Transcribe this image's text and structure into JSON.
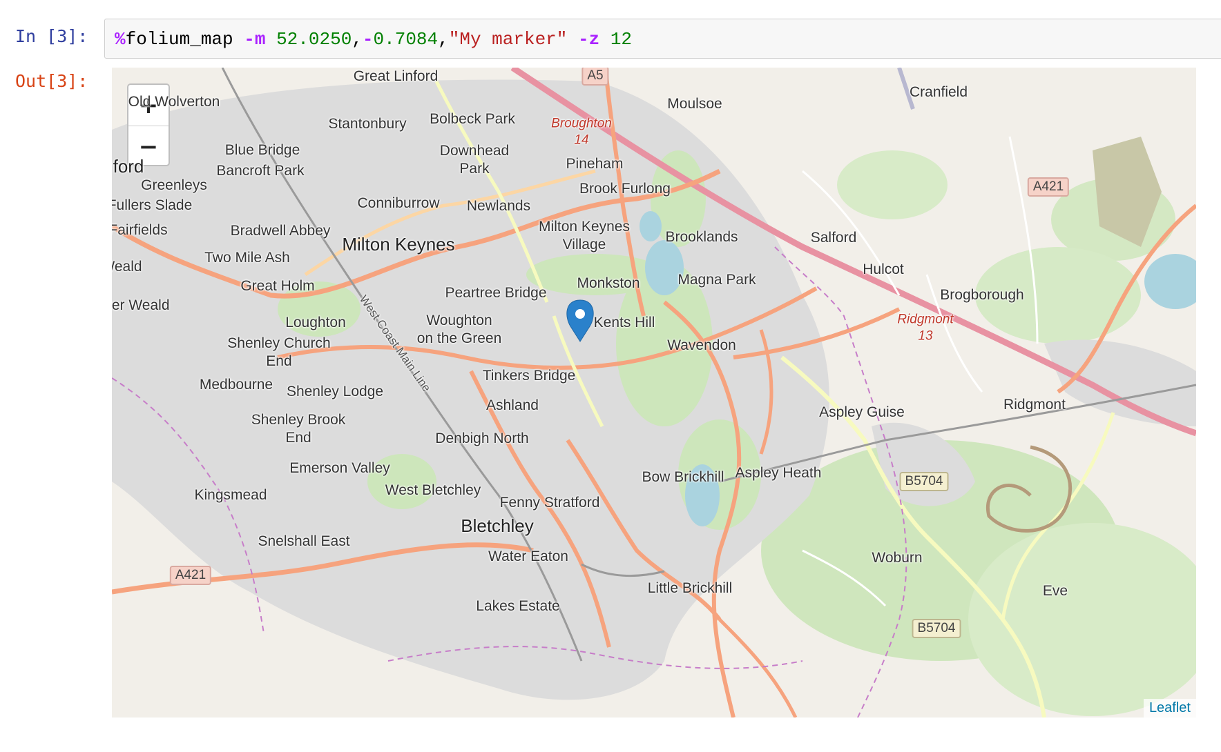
{
  "cell": {
    "in_prompt": "In [3]:",
    "out_prompt": "Out[3]:",
    "code": {
      "magic": "%",
      "name": "folium_map",
      "flag_m": "-m",
      "lat": "52.0250",
      "comma1": ",",
      "minus": "-",
      "lon": "0.7084",
      "comma2": ",",
      "label": "\"My marker\"",
      "flag_z": "-z",
      "zoom": "12"
    }
  },
  "map": {
    "controls": {
      "zoom_in": "+",
      "zoom_out": "−"
    },
    "attribution": "Leaflet",
    "marker": {
      "lat": 52.025,
      "lon": -0.7084,
      "popup": "My marker"
    },
    "labels": {
      "great_linford": "Great Linford",
      "old_wolverton": "Old Wolverton",
      "stantonbury": "Stantonbury",
      "bolbeck_park": "Bolbeck Park",
      "blue_bridge": "Blue Bridge",
      "bancroft_park": "Bancroft Park",
      "stratford": "ford",
      "greenleys": "Greenleys",
      "fullers_slade": "Fullers Slade",
      "fairfields": "Fairfields",
      "downhead_park": "Downhead\nPark",
      "conniburrow": "Conniburrow",
      "newlands": "Newlands",
      "bradwell_abbey": "Bradwell Abbey",
      "milton_keynes": "Milton Keynes",
      "two_mile_ash": "Two Mile Ash",
      "weald": "Weald",
      "great_holm": "Great Holm",
      "upper_weald": "pper Weald",
      "loughton": "Loughton",
      "shenley_church_end": "Shenley Church\nEnd",
      "medbourne": "Medbourne",
      "shenley_lodge": "Shenley Lodge",
      "shenley_brook_end": "Shenley Brook\nEnd",
      "emerson_valley": "Emerson Valley",
      "kingsmead": "Kingsmead",
      "west_bletchley": "West Bletchley",
      "snelshall_east": "Snelshall East",
      "bletchley": "Bletchley",
      "fenny_stratford": "Fenny Stratford",
      "water_eaton": "Water Eaton",
      "lakes_estate": "Lakes Estate",
      "denbigh_north": "Denbigh North",
      "ashland": "Ashland",
      "tinkers_bridge": "Tinkers Bridge",
      "woughton": "Woughton\non the Green",
      "peartree_bridge": "Peartree Bridge",
      "monkston": "Monkston",
      "kents_hill": "Kents Hill",
      "mk_village": "Milton Keynes\nVillage",
      "pineham": "Pineham",
      "brook_furlong": "Brook Furlong",
      "broughton": "Broughton\n14",
      "moulsoe": "Moulsoe",
      "brooklands": "Brooklands",
      "magna_park": "Magna Park",
      "wavendon": "Wavendon",
      "salford": "Salford",
      "hulcot": "Hulcot",
      "cranfield": "Cranfield",
      "brogborough": "Brogborough",
      "ridgmont_junction": "Ridgmont\n13",
      "ridgmont": "Ridgmont",
      "aspley_guise": "Aspley Guise",
      "aspley_heath": "Aspley Heath",
      "bow_brickhill": "Bow Brickhill",
      "little_brickhill": "Little Brickhill",
      "woburn": "Woburn",
      "eversholt": "Eve",
      "west_coast_main_line": "West Coast Main Line"
    },
    "shields": {
      "a5": "A5",
      "a421_left": "A421",
      "a421_right": "A421",
      "b5704_a": "B5704",
      "b5704_b": "B5704"
    }
  }
}
